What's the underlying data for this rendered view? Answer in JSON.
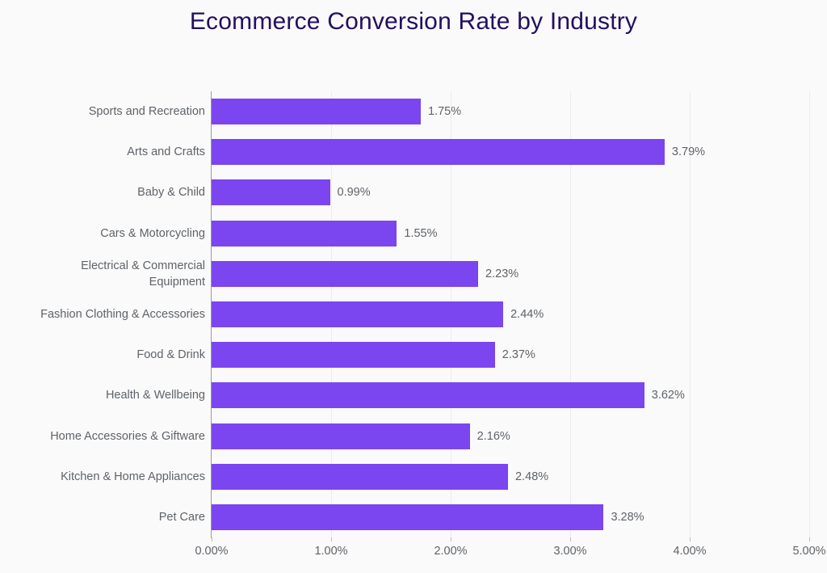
{
  "chart_data": {
    "type": "bar",
    "orientation": "horizontal",
    "title": "Ecommerce Conversion Rate by Industry",
    "xlabel": "",
    "ylabel": "",
    "xlim": [
      0,
      5
    ],
    "xticks": [
      "0.00%",
      "1.00%",
      "2.00%",
      "3.00%",
      "4.00%",
      "5.00%"
    ],
    "xtick_values": [
      0,
      1,
      2,
      3,
      4,
      5
    ],
    "grid": true,
    "grid_axis": "x",
    "legend": false,
    "categories": [
      "Sports and Recreation",
      "Arts and Crafts",
      "Baby & Child",
      "Cars & Motorcycling",
      "Electrical & Commercial\nEquipment",
      "Fashion Clothing & Accessories",
      "Food & Drink",
      "Health & Wellbeing",
      "Home Accessories & Giftware",
      "Kitchen & Home Appliances",
      "Pet Care"
    ],
    "values": [
      1.75,
      3.79,
      0.99,
      1.55,
      2.23,
      2.44,
      2.37,
      3.62,
      2.16,
      2.48,
      3.28
    ],
    "value_labels": [
      "1.75%",
      "3.79%",
      "0.99%",
      "1.55%",
      "2.23%",
      "2.44%",
      "2.37%",
      "3.62%",
      "2.16%",
      "2.48%",
      "3.28%"
    ],
    "bars": [
      {
        "label": "Sports and Recreation",
        "value": 1.75,
        "value_label": "1.75%"
      },
      {
        "label": "Arts and Crafts",
        "value": 3.79,
        "value_label": "3.79%"
      },
      {
        "label": "Baby & Child",
        "value": 0.99,
        "value_label": "0.99%"
      },
      {
        "label": "Cars & Motorcycling",
        "value": 1.55,
        "value_label": "1.55%"
      },
      {
        "label": "Electrical & Commercial\nEquipment",
        "value": 2.23,
        "value_label": "2.23%"
      },
      {
        "label": "Fashion Clothing & Accessories",
        "value": 2.44,
        "value_label": "2.44%"
      },
      {
        "label": "Food & Drink",
        "value": 2.37,
        "value_label": "2.37%"
      },
      {
        "label": "Health & Wellbeing",
        "value": 3.62,
        "value_label": "3.62%"
      },
      {
        "label": "Home Accessories & Giftware",
        "value": 2.16,
        "value_label": "2.16%"
      },
      {
        "label": "Kitchen & Home Appliances",
        "value": 2.48,
        "value_label": "2.48%"
      },
      {
        "label": "Pet Care",
        "value": 3.28,
        "value_label": "3.28%"
      }
    ],
    "colors": {
      "bar": "#7b45f0",
      "background": "#fafafa",
      "title": "#221060",
      "text": "#5f6368",
      "gridline": "#ececec",
      "axis": "#9a9a9a"
    }
  }
}
